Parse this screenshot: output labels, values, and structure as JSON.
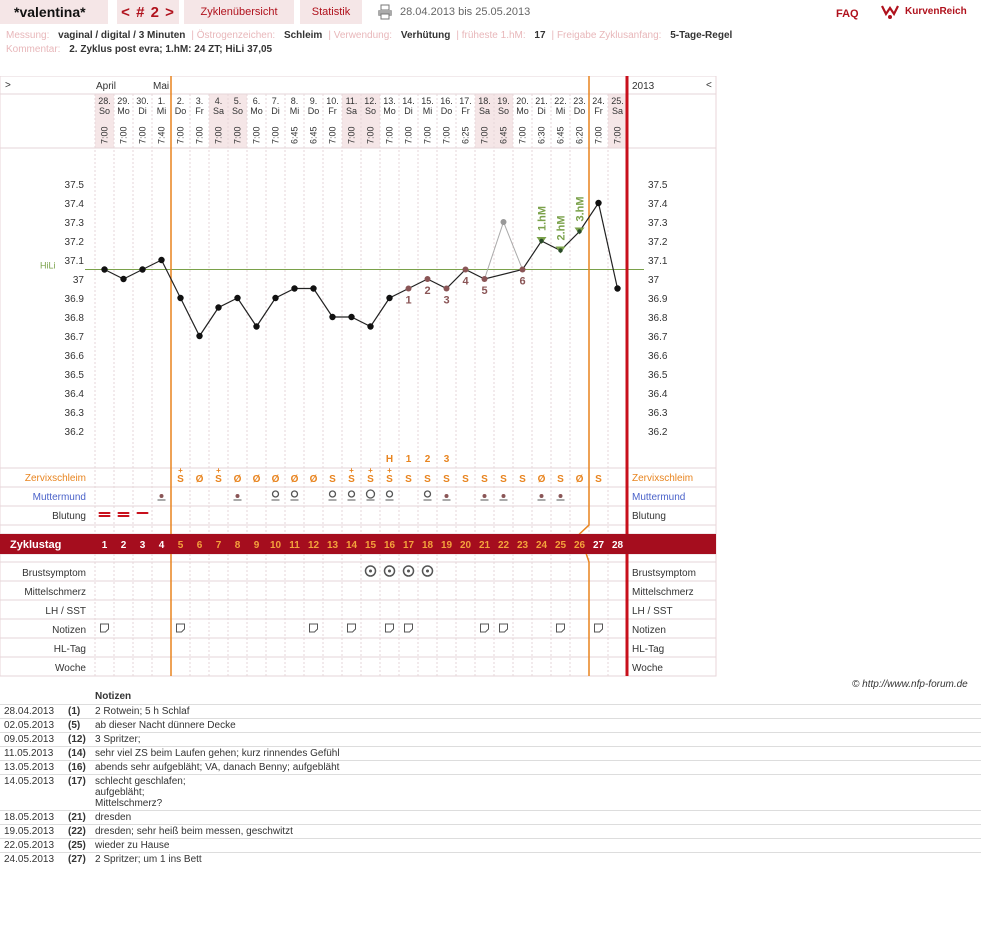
{
  "header": {
    "user": "*valentina*",
    "nav": "< # 2 >",
    "tabs": [
      "Zyklenübersicht",
      "Statistik"
    ],
    "range": "28.04.2013 bis 25.05.2013",
    "faq": "FAQ",
    "logo": "KurvenReich"
  },
  "meta": {
    "mess_k": "Messung:",
    "mess_v": "vaginal / digital / 3 Minuten",
    "oest_k": "Östrogenzeichen:",
    "oest_v": "Schleim",
    "verw_k": "Verwendung:",
    "verw_v": "Verhütung",
    "hm_k": "früheste 1.hM:",
    "hm_v": "17",
    "frei_k": "Freigabe Zyklusanfang:",
    "frei_v": "5-Tage-Regel",
    "komm_k": "Kommentar:",
    "komm_v": "2. Zyklus post evra; 1.hM: 24 ZT; HiLi 37,05"
  },
  "chart_data": {
    "type": "line",
    "title": "Temperaturkurve",
    "year": "2013",
    "months": [
      {
        "label": "April",
        "col": 0
      },
      {
        "label": "Mai",
        "col": 3
      }
    ],
    "days": [
      "28.",
      "29.",
      "30.",
      "1.",
      "2.",
      "3.",
      "4.",
      "5.",
      "6.",
      "7.",
      "8.",
      "9.",
      "10.",
      "11.",
      "12.",
      "13.",
      "14.",
      "15.",
      "16.",
      "17.",
      "18.",
      "19.",
      "20.",
      "21.",
      "22.",
      "23.",
      "24.",
      "25."
    ],
    "weekdays": [
      "So",
      "Mo",
      "Di",
      "Mi",
      "Do",
      "Fr",
      "Sa",
      "So",
      "Mo",
      "Di",
      "Mi",
      "Do",
      "Fr",
      "Sa",
      "So",
      "Mo",
      "Di",
      "Mi",
      "Do",
      "Fr",
      "Sa",
      "So",
      "Mo",
      "Di",
      "Mi",
      "Do",
      "Fr",
      "Sa"
    ],
    "weekend_cols": [
      0,
      6,
      7,
      13,
      14,
      20,
      21,
      27
    ],
    "times": [
      "7:00",
      "7:00",
      "7:00",
      "7:40",
      "7:00",
      "7:00",
      "7:00",
      "7:00",
      "7:00",
      "7:00",
      "6:45",
      "6:45",
      "7:00",
      "7:00",
      "7:00",
      "7:00",
      "7:00",
      "7:00",
      "7:00",
      "6:25",
      "7:00",
      "6:45",
      "7:00",
      "6:30",
      "6:45",
      "6:20",
      "7:00",
      "7:00"
    ],
    "temps": [
      37.05,
      37.0,
      37.05,
      37.1,
      36.9,
      36.7,
      36.85,
      36.9,
      36.75,
      36.9,
      36.95,
      36.95,
      36.8,
      36.8,
      36.75,
      36.9,
      36.95,
      37.0,
      36.95,
      37.05,
      37.0,
      37.3,
      37.05,
      37.2,
      37.15,
      37.25,
      37.4,
      36.95
    ],
    "excluded": [
      21
    ],
    "ylim": [
      36.15,
      37.6
    ],
    "yticks": [
      "37.5",
      "37.4",
      "37.3",
      "37.2",
      "37.1",
      "37",
      "36.9",
      "36.8",
      "36.7",
      "36.6",
      "36.5",
      "36.4",
      "36.3",
      "36.2"
    ],
    "hili": 37.05,
    "hili_label": "HiLi",
    "low_nums": [
      {
        "col": 16,
        "t": "1"
      },
      {
        "col": 17,
        "t": "2"
      },
      {
        "col": 18,
        "t": "3"
      },
      {
        "col": 19,
        "t": "4"
      },
      {
        "col": 20,
        "t": "5"
      },
      {
        "col": 22,
        "t": "6"
      }
    ],
    "high_labels": [
      {
        "col": 23,
        "t": "1.hM"
      },
      {
        "col": 24,
        "t": "2.hM"
      },
      {
        "col": 25,
        "t": "3.hM"
      }
    ],
    "peak": [
      {
        "col": 15,
        "t": "H"
      },
      {
        "col": 16,
        "t": "1"
      },
      {
        "col": 17,
        "t": "2"
      },
      {
        "col": 18,
        "t": "3"
      }
    ],
    "mucus": [
      "",
      "",
      "",
      "",
      "S",
      "Ø",
      "S",
      "Ø",
      "Ø",
      "Ø",
      "Ø",
      "Ø",
      "S",
      "S",
      "S",
      "S",
      "S",
      "S",
      "S",
      "S",
      "S",
      "S",
      "S",
      "Ø",
      "S",
      "Ø",
      "S",
      ""
    ],
    "mucus_plus": [
      4,
      6,
      13,
      14,
      15
    ],
    "cervix": [
      {
        "col": 3,
        "t": "•"
      },
      {
        "col": 7,
        "t": "•"
      },
      {
        "col": 9,
        "t": "o"
      },
      {
        "col": 10,
        "t": "o"
      },
      {
        "col": 12,
        "t": "o"
      },
      {
        "col": 13,
        "t": "o"
      },
      {
        "col": 14,
        "t": "O"
      },
      {
        "col": 15,
        "t": "o"
      },
      {
        "col": 17,
        "t": "o"
      },
      {
        "col": 18,
        "t": "•"
      },
      {
        "col": 20,
        "t": "•"
      },
      {
        "col": 21,
        "t": "•"
      },
      {
        "col": 23,
        "t": "•"
      },
      {
        "col": 24,
        "t": "•"
      }
    ],
    "bleeding": [
      {
        "col": 0,
        "t": "2"
      },
      {
        "col": 1,
        "t": "2"
      },
      {
        "col": 2,
        "t": "1"
      }
    ],
    "cycle_label": "Zyklustag",
    "cycle_days": [
      "1",
      "2",
      "3",
      "4",
      "5",
      "6",
      "7",
      "8",
      "9",
      "10",
      "11",
      "12",
      "13",
      "14",
      "15",
      "16",
      "17",
      "18",
      "19",
      "20",
      "21",
      "22",
      "23",
      "24",
      "25",
      "26",
      "27",
      "28"
    ],
    "breast": [
      14,
      15,
      16,
      17
    ],
    "notes_cols": [
      0,
      4,
      11,
      13,
      15,
      16,
      20,
      21,
      24,
      26
    ],
    "row_labels": {
      "left": [
        "Zervixschleim",
        "Muttermund",
        "Blutung",
        "",
        "Brustsymptom",
        "Mittelschmerz",
        "LH / SST",
        "Notizen",
        "HL-Tag",
        "Woche"
      ],
      "right": [
        "Zervixschleim",
        "Muttermund",
        "Blutung",
        "",
        "Brustsymptom",
        "Mittelschmerz",
        "LH / SST",
        "Notizen",
        "HL-Tag",
        "Woche"
      ]
    },
    "colors": {
      "accent": "#a50d1e",
      "line": "#e8841f",
      "hili": "#7aa14a",
      "pink": "#f5e6e7"
    }
  },
  "copyright": "© http://www.nfp-forum.de",
  "notes_title": "Notizen",
  "notes": [
    {
      "date": "28.04.2013",
      "day": "(1)",
      "text": "2 Rotwein; 5 h Schlaf"
    },
    {
      "date": "02.05.2013",
      "day": "(5)",
      "text": "ab dieser Nacht dünnere Decke"
    },
    {
      "date": "09.05.2013",
      "day": "(12)",
      "text": "3 Spritzer;"
    },
    {
      "date": "11.05.2013",
      "day": "(14)",
      "text": "sehr viel ZS beim Laufen gehen; kurz rinnendes Gefühl"
    },
    {
      "date": "13.05.2013",
      "day": "(16)",
      "text": "abends sehr aufgebläht; VA, danach Benny; aufgebläht"
    },
    {
      "date": "14.05.2013",
      "day": "(17)",
      "text": "schlecht geschlafen;\naufgebläht;\nMittelschmerz?"
    },
    {
      "date": "18.05.2013",
      "day": "(21)",
      "text": "dresden"
    },
    {
      "date": "19.05.2013",
      "day": "(22)",
      "text": "dresden; sehr heiß beim messen, geschwitzt"
    },
    {
      "date": "22.05.2013",
      "day": "(25)",
      "text": "wieder zu Hause"
    },
    {
      "date": "24.05.2013",
      "day": "(27)",
      "text": "2 Spritzer; um 1 ins Bett"
    }
  ]
}
